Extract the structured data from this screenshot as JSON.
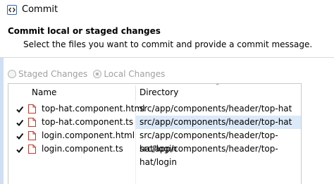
{
  "window": {
    "title": "Commit"
  },
  "header": {
    "title": "Commit local or staged changes",
    "subtitle": "Select the files you want to commit and provide a commit message."
  },
  "mode": {
    "options": [
      {
        "label": "Staged Changes",
        "selected": false
      },
      {
        "label": "Local Changes",
        "selected": true
      }
    ]
  },
  "table": {
    "columns": [
      "Name",
      "Directory"
    ],
    "rows": [
      {
        "checked": true,
        "name": "top-hat.component.html",
        "directory": "src/app/components/header/top-hat",
        "selected": false
      },
      {
        "checked": true,
        "name": "top-hat.component.ts",
        "directory": "src/app/components/header/top-hat",
        "selected": true
      },
      {
        "checked": true,
        "name": "login.component.html",
        "directory": "src/app/components/header/top-hat/login",
        "selected": false
      },
      {
        "checked": true,
        "name": "login.component.ts",
        "directory": "src/app/components/header/top-hat/login",
        "selected": false
      }
    ]
  },
  "icons": {
    "app": "eclipse-commit-icon",
    "sort": "sort-ascending-icon",
    "file": "file-icon",
    "check": "checkmark-icon"
  },
  "colors": {
    "selection": "#dce9f8",
    "file_icon": "#c0392b",
    "accent_band": "#cfe0f3"
  }
}
